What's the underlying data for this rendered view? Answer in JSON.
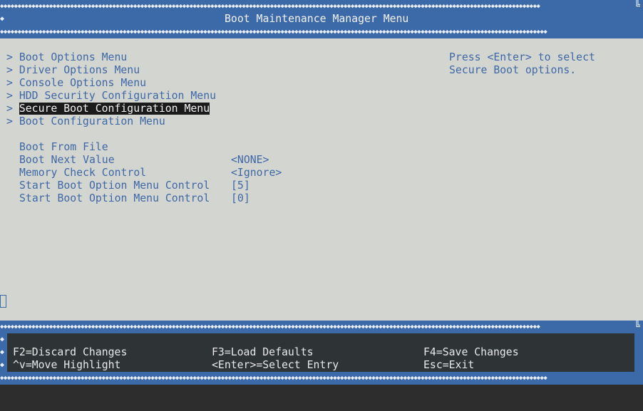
{
  "header": {
    "title": "Boot Maintenance Manager Menu"
  },
  "menu": {
    "items": [
      {
        "marker": ">",
        "label": "Boot Options Menu"
      },
      {
        "marker": ">",
        "label": "Driver Options Menu"
      },
      {
        "marker": ">",
        "label": "Console Options Menu"
      },
      {
        "marker": ">",
        "label": "HDD Security Configuration Menu"
      },
      {
        "marker": ">",
        "label": "Secure Boot Configuration Menu",
        "selected": true
      },
      {
        "marker": ">",
        "label": "Boot Configuration Menu"
      }
    ],
    "options": [
      {
        "label": "Boot From File",
        "value": ""
      },
      {
        "label": "Boot Next Value",
        "value": "<NONE>"
      },
      {
        "label": "Memory Check Control",
        "value": "<Ignore>"
      },
      {
        "label": "Start Boot Option Menu Control",
        "value": "[5]"
      },
      {
        "label": "Start Boot Option Menu Control",
        "value": "[0]"
      }
    ]
  },
  "help": {
    "line1": "Press <Enter> to select",
    "line2": "Secure Boot options."
  },
  "footer": {
    "f2": "F2=Discard Changes",
    "f3": "F3=Load Defaults",
    "f4": "F4=Save Changes",
    "move": "^v=Move Highlight",
    "enter": "<Enter>=Select Entry",
    "esc": "Esc=Exit"
  },
  "colors": {
    "frame_blue": "#3c69a8",
    "body_gray": "#d3d6d0",
    "text_blue": "#3f67a6",
    "footer_dark": "#2e3436",
    "highlight_bg": "#1b1b1b"
  }
}
